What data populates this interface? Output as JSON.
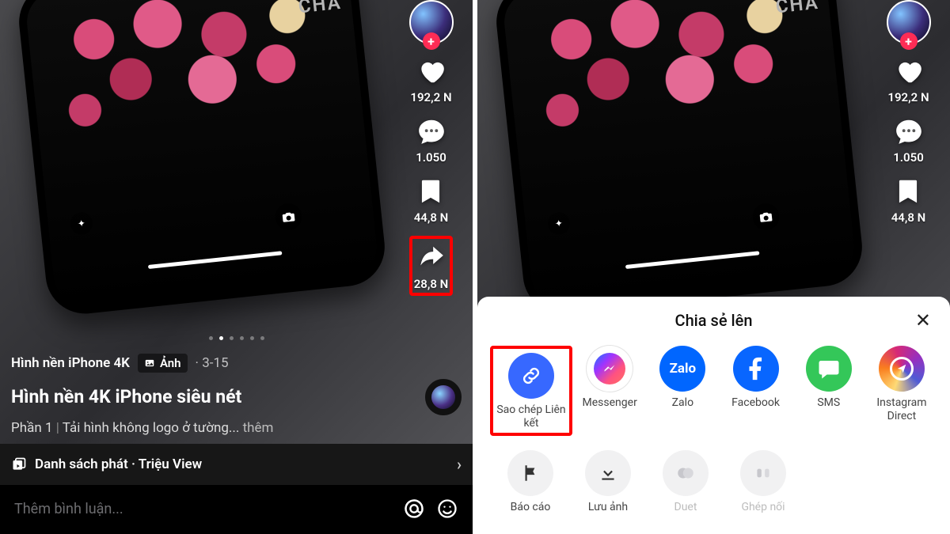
{
  "common": {
    "brand_text": "CHA",
    "avatar_plus": "+"
  },
  "actions": {
    "likes": "192,2 N",
    "comments": "1.050",
    "bookmarks": "44,8 N",
    "shares": "28,8 N"
  },
  "left": {
    "username": "Hình nền iPhone 4K",
    "badge_label": "Ảnh",
    "date": "3-15",
    "caption": "Hình nền 4K iPhone siêu nét",
    "desc_prefix": "Phần 1",
    "desc_rest": "Tải hình không logo ở tường...",
    "desc_more": "thêm",
    "playlist": "Danh sách phát · Triệu View",
    "comment_placeholder": "Thêm bình luận...",
    "active_dot_index": 1,
    "dot_count": 6
  },
  "sheet": {
    "title": "Chia sẻ lên",
    "items_row1": [
      {
        "key": "copy",
        "label": "Sao chép Liên kết"
      },
      {
        "key": "messenger",
        "label": "Messenger"
      },
      {
        "key": "zalo",
        "label": "Zalo",
        "text": "Zalo"
      },
      {
        "key": "facebook",
        "label": "Facebook"
      },
      {
        "key": "sms",
        "label": "SMS"
      },
      {
        "key": "instagram",
        "label": "Instagram Direct"
      }
    ],
    "items_row2": [
      {
        "key": "report",
        "label": "Báo cáo"
      },
      {
        "key": "save",
        "label": "Lưu ảnh"
      },
      {
        "key": "duet",
        "label": "Duet"
      },
      {
        "key": "stitch",
        "label": "Ghép nối"
      }
    ]
  }
}
